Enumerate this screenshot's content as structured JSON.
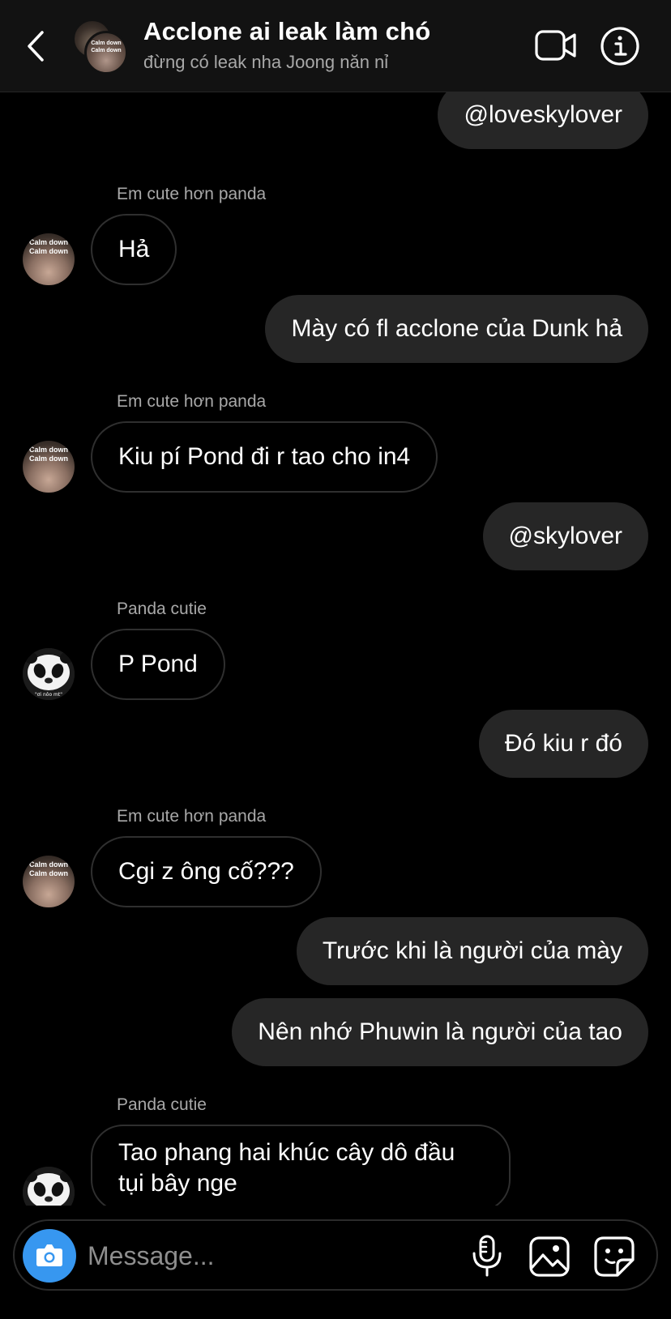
{
  "header": {
    "title": "Acclone ai leak làm chó",
    "subtitle": "đừng có leak nha Joong năn nỉ",
    "avatar_text": [
      "Calm down",
      "Calm down"
    ]
  },
  "messages": [
    {
      "side": "out",
      "text": "@loveskylover"
    },
    {
      "side": "in",
      "sender": "Em cute hơn panda",
      "avatar": "human",
      "text": "Hả"
    },
    {
      "side": "out",
      "text": "Mày có fl acclone của Dunk hả"
    },
    {
      "side": "in",
      "sender": "Em cute hơn panda",
      "avatar": "human",
      "text": "Kiu pí Pond đi r tao cho in4"
    },
    {
      "side": "out",
      "text": "@skylover"
    },
    {
      "side": "in",
      "sender": "Panda cutie",
      "avatar": "panda",
      "text": "P Pond"
    },
    {
      "side": "out",
      "text": "Đó kiu r đó"
    },
    {
      "side": "in",
      "sender": "Em cute hơn panda",
      "avatar": "human",
      "text": "Cgi z ông cố???"
    },
    {
      "side": "out",
      "text": "Trước khi là người của mày"
    },
    {
      "side": "out",
      "text": "Nên nhớ Phuwin là người của tao"
    },
    {
      "side": "in",
      "sender": "Panda cutie",
      "avatar": "panda",
      "text": "Tao phang hai khúc cây dô đầu tụi bây nge"
    }
  ],
  "avatar_human_text": [
    "Calm down",
    "Calm down"
  ],
  "avatar_panda_caption": "\"ơi nôo mt\"",
  "composer": {
    "placeholder": "Message..."
  },
  "icons": {
    "back": "chevron-left-icon",
    "video": "video-camera-icon",
    "info": "info-icon",
    "camera": "camera-icon",
    "mic": "microphone-icon",
    "gallery": "image-icon",
    "sticker": "sticker-icon"
  },
  "colors": {
    "background": "#000000",
    "header": "#121212",
    "outgoing_bubble": "#262626",
    "incoming_border": "#2f2f2f",
    "camera_button": "#3797f0",
    "secondary_text": "#a8a8a8"
  }
}
